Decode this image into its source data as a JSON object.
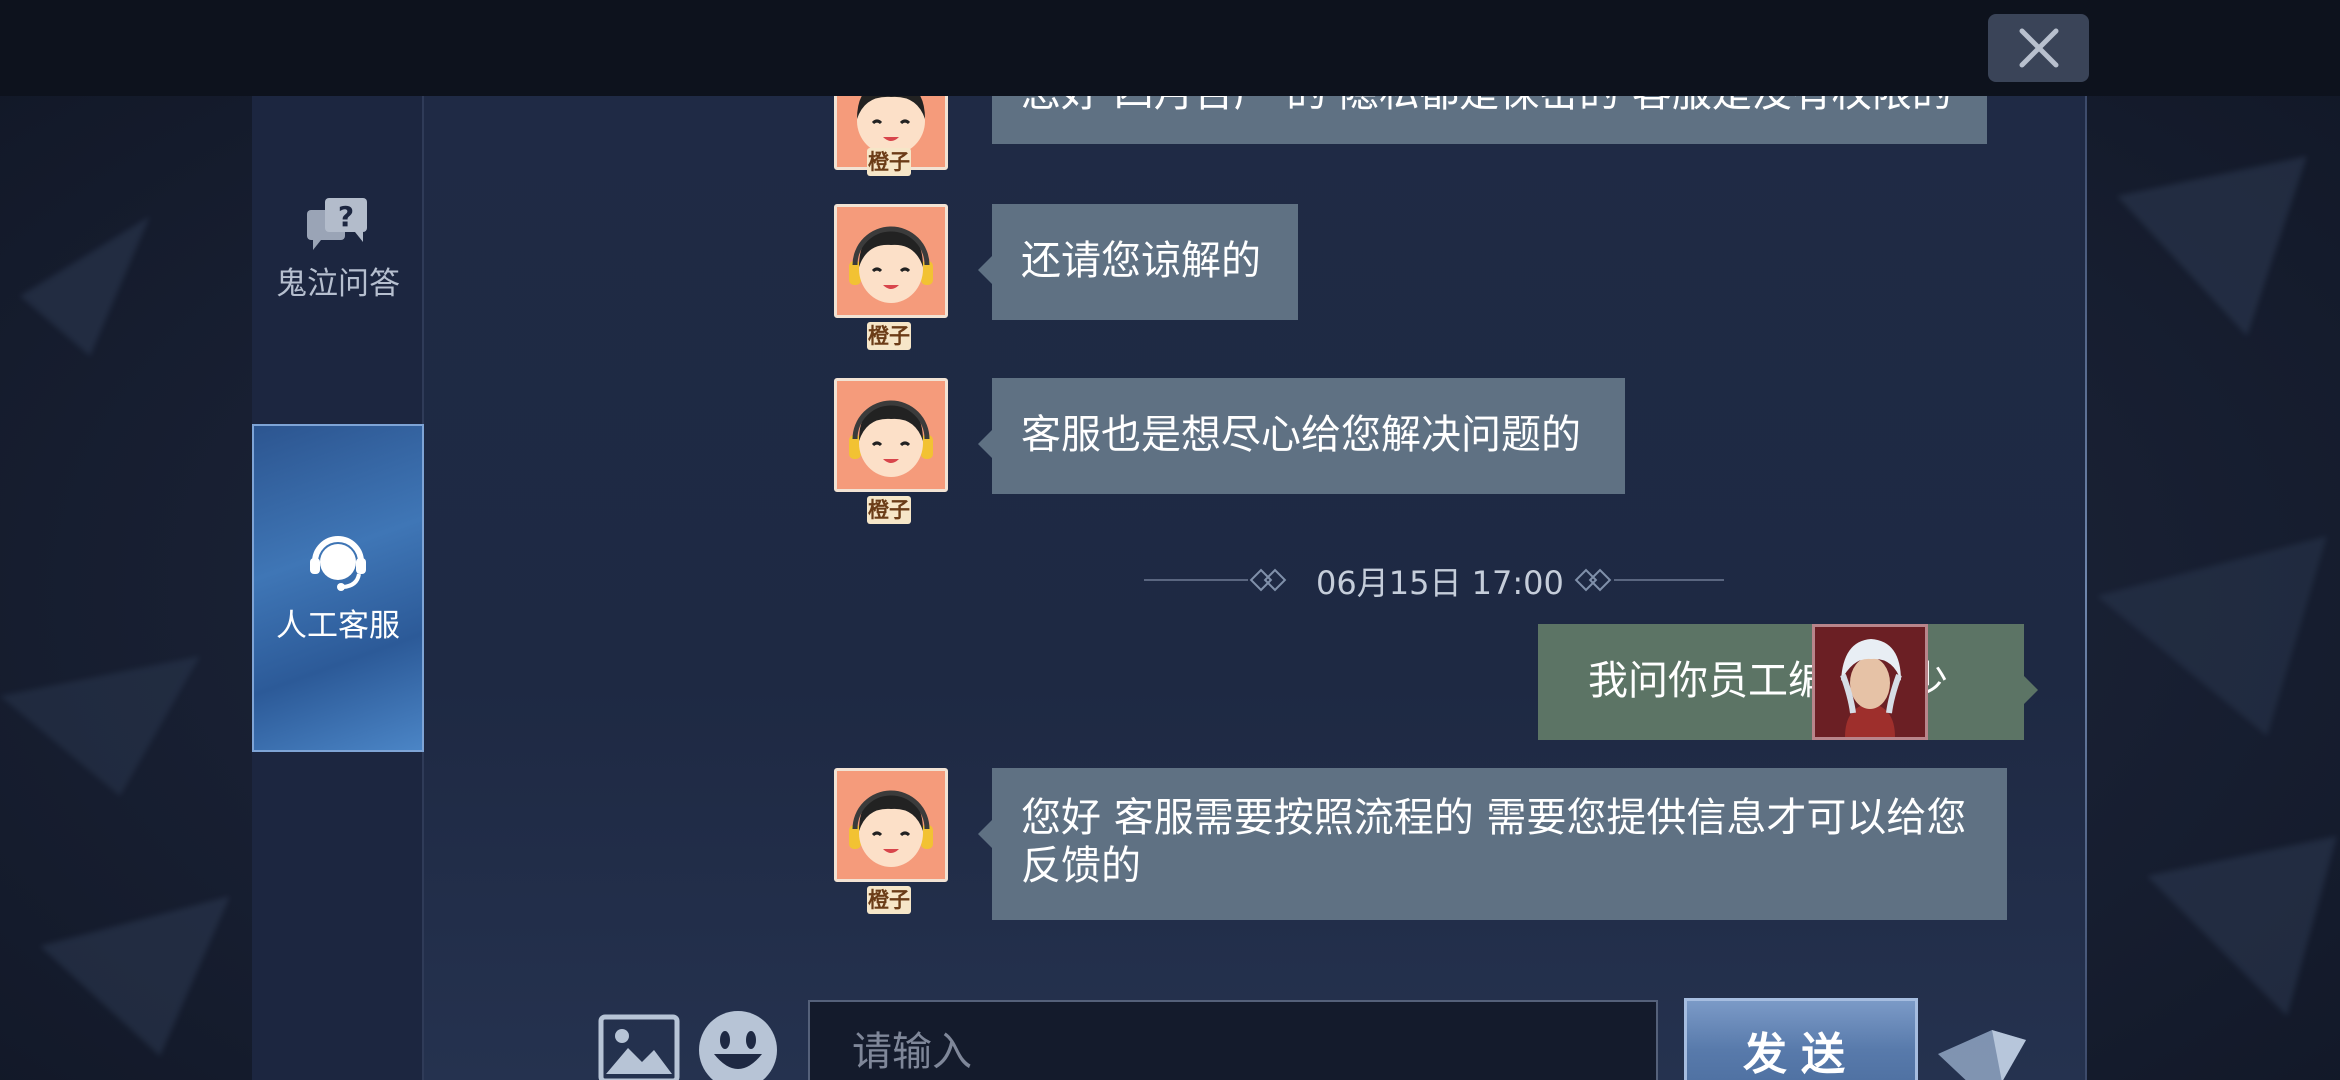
{
  "window": {
    "close_icon": "close-icon"
  },
  "sidebar": {
    "items": [
      {
        "label": "鬼泣问答",
        "icon": "question-chat-icon",
        "active": false
      },
      {
        "label": "人工客服",
        "icon": "headset-agent-icon",
        "active": true
      }
    ]
  },
  "agent": {
    "name": "橙子"
  },
  "messages": [
    {
      "sender": "agent",
      "text": "您好 四月否产 的 隐私都是保密的 客服是没有权限的"
    },
    {
      "sender": "agent",
      "text": "还请您谅解的"
    },
    {
      "sender": "agent",
      "text": "客服也是想尽心给您解决问题的"
    },
    {
      "type": "timestamp",
      "text": "06月15日 17:00"
    },
    {
      "sender": "user",
      "text": "我问你员工编号多少"
    },
    {
      "sender": "agent",
      "text": "您好  客服需要按照流程的  需要您提供信息才可以给您反馈的"
    }
  ],
  "input": {
    "placeholder": "请输入",
    "image_icon": "image-icon",
    "emoji_icon": "emoji-icon",
    "send_label": "发送"
  },
  "colors": {
    "agent_bubble": "#5f7183",
    "user_bubble": "#5c7465",
    "send_button": "#587aab"
  }
}
